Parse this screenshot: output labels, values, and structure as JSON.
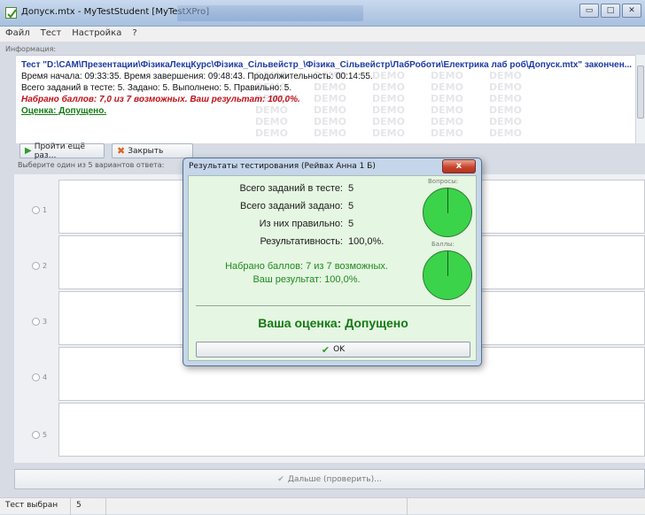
{
  "window": {
    "title": "Допуск.mtx - MyTestStudent [MyTestXPro]",
    "buttons": [
      "▭",
      "□",
      "✕"
    ]
  },
  "menu": [
    "Файл",
    "Тест",
    "Настройка",
    "?"
  ],
  "info": {
    "label": "Информация:",
    "title_line": "Тест \"D:\\САМ\\Презентации\\ФізикаЛекцКурс\\Фізика_Сільвейстр_\\Фізика_Сільвейстр\\ЛабРоботи\\Електрика лаб роб\\Допуск.mtx\" закончен...",
    "times": "Время начала: 09:33:35. Время завершения: 09:48:43. Продолжительность: 00:14:55.",
    "counts": "Всего заданий в тесте: 5. Задано: 5. Выполнено: 5. Правильно: 5.",
    "score": "Набрано баллов: 7,0 из 7 возможных. Ваш результат: 100,0%.",
    "grade": "Оценка: Допущено.",
    "watermark": "DEMO"
  },
  "actions": {
    "retry": "Пройти ещё раз...",
    "close": "Закрыть"
  },
  "question": {
    "prompt": "Выберите один из 5 вариантов ответа:",
    "options": [
      "1",
      "2",
      "3",
      "4",
      "5"
    ]
  },
  "next_button": "Дальше (проверить)...",
  "status": {
    "left": "Тест выбран",
    "count": "5"
  },
  "dialog": {
    "title": "Результаты тестирования (Рейвах Анна 1 Б)",
    "close": "x",
    "stats": [
      {
        "label": "Всего заданий в тесте:",
        "value": "5"
      },
      {
        "label": "Всего заданий задано:",
        "value": "5"
      },
      {
        "label": "Из них правильно:",
        "value": "5"
      },
      {
        "label": "Результативность:",
        "value": "100,0%."
      }
    ],
    "pie_questions_label": "Вопросы:",
    "pie_points_label": "Баллы:",
    "pie_questions_fraction": 1.0,
    "pie_points_fraction": 1.0,
    "points_line": "Набрано баллов: 7 из 7 возможных.",
    "result_line": "Ваш результат: 100,0%.",
    "grade": "Ваша оценка: Допущено",
    "ok": "OK"
  },
  "colors": {
    "title_blue": "#1c3aa6",
    "score_red": "#c0121a",
    "grade_green": "#167a16",
    "pie_green": "#3bd34a",
    "dialog_bg": "#e5f6e2"
  }
}
